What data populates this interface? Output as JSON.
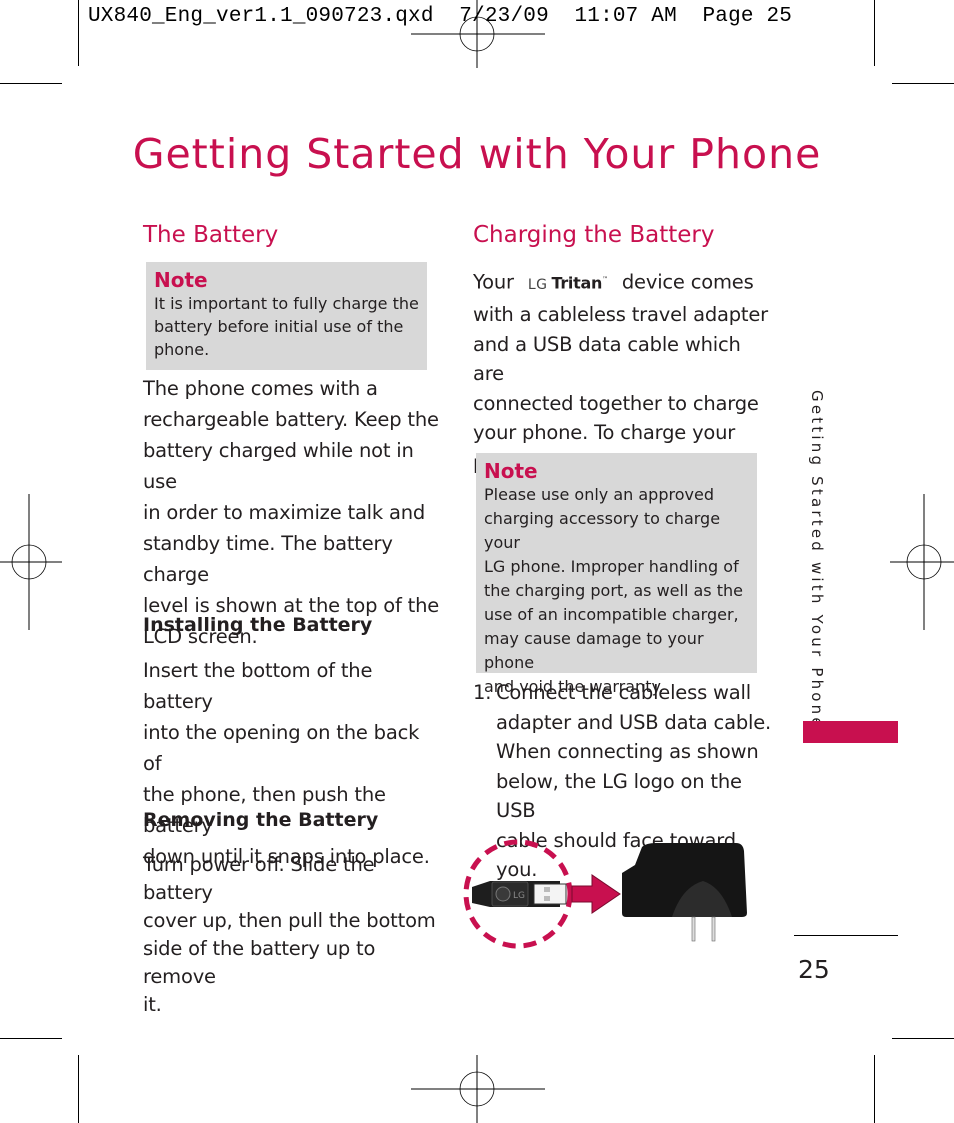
{
  "print_slug": "UX840_Eng_ver1.1_090723.qxd  7/23/09  11:07 AM  Page 25",
  "page_title": "Getting Started with Your Phone",
  "side_tab_label": "Getting Started with Your Phone",
  "page_number": "25",
  "colors": {
    "accent": "#c8104f",
    "note_bg": "#d8d8d8",
    "text": "#231f20"
  },
  "left_column": {
    "heading": "The Battery",
    "note": {
      "title": "Note",
      "lines": [
        "It is important to fully charge the",
        "battery before initial use of the",
        "phone."
      ]
    },
    "intro_lines": [
      "The phone comes with a",
      "rechargeable battery. Keep the",
      "battery charged while not in use",
      "in order to maximize talk and",
      "standby time. The battery charge",
      "level is shown at the top of the",
      "LCD screen."
    ],
    "installing": {
      "heading": "Installing the Battery",
      "lines": [
        "Insert the bottom of the battery",
        "into the opening on the back of",
        "the phone, then push the battery",
        "down until it snaps into place."
      ]
    },
    "removing": {
      "heading": "Removing the Battery",
      "lines": [
        "Turn power off. Slide the battery",
        "cover up, then pull the bottom",
        "side of the battery up to remove",
        "it."
      ]
    }
  },
  "right_column": {
    "heading": "Charging the Battery",
    "intro": {
      "prefix": "Your",
      "brand_logo": "LG",
      "brand_name": "Tritan",
      "brand_tm": "™",
      "first_line_suffix": "device comes",
      "lines": [
        "with a cableless travel adapter",
        "and a USB data cable which are",
        "connected together to charge",
        "your phone. To charge your",
        "phone:"
      ]
    },
    "note": {
      "title": "Note",
      "lines": [
        "Please use only an approved",
        "charging accessory to charge your",
        "LG phone. Improper handling of",
        "the charging port, as well as the",
        "use of an incompatible charger,",
        "may cause damage to your phone",
        "and void  the warranty."
      ]
    },
    "step": {
      "number": "1.",
      "lines": [
        "Connect the cableless wall",
        "adapter and USB data cable.",
        "When connecting as shown",
        "below, the LG logo on the USB",
        "cable should face toward you."
      ]
    },
    "illustration": {
      "usb_logo_text": "LG",
      "items": [
        "usb-cable-plug-icon",
        "arrow-right-icon",
        "wall-adapter-icon"
      ]
    }
  }
}
